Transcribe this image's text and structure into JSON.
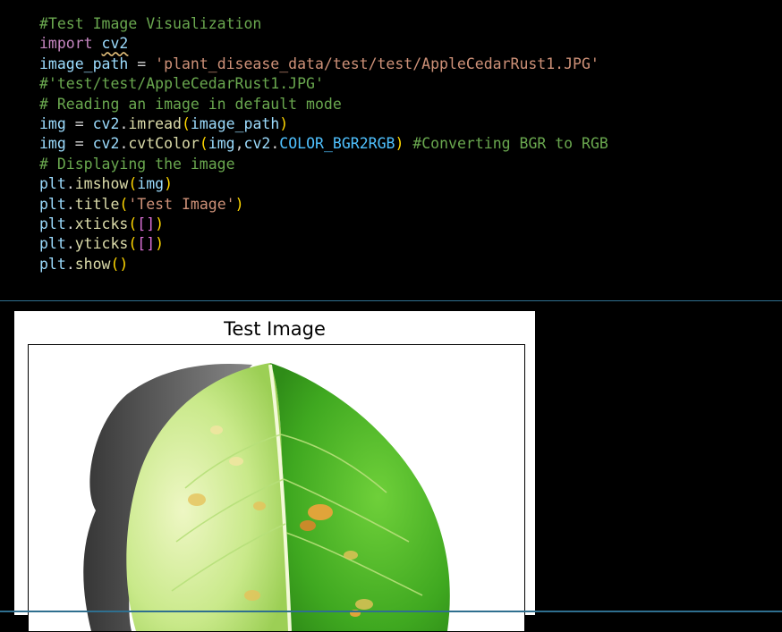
{
  "code_cell": {
    "lines": [
      [
        {
          "t": "#Test Image Visualization",
          "c": "c-comment"
        }
      ],
      [
        {
          "t": "import ",
          "c": "c-key"
        },
        {
          "t": "cv2",
          "c": "c-var squiggle"
        }
      ],
      [
        {
          "t": "image_path",
          "c": "c-var"
        },
        {
          "t": " = ",
          "c": "c-plain"
        },
        {
          "t": "'plant_disease_data/test/test/AppleCedarRust1.JPG'",
          "c": "c-str"
        }
      ],
      [
        {
          "t": "#'test/test/AppleCedarRust1.JPG'",
          "c": "c-comment"
        }
      ],
      [
        {
          "t": "# Reading an image in default mode",
          "c": "c-comment"
        }
      ],
      [
        {
          "t": "img",
          "c": "c-var"
        },
        {
          "t": " = ",
          "c": "c-plain"
        },
        {
          "t": "cv2",
          "c": "c-var"
        },
        {
          "t": ".",
          "c": "c-plain"
        },
        {
          "t": "imread",
          "c": "c-fn"
        },
        {
          "t": "(",
          "c": "c-paren"
        },
        {
          "t": "image_path",
          "c": "c-var"
        },
        {
          "t": ")",
          "c": "c-paren"
        }
      ],
      [
        {
          "t": "img",
          "c": "c-var"
        },
        {
          "t": " = ",
          "c": "c-plain"
        },
        {
          "t": "cv2",
          "c": "c-var"
        },
        {
          "t": ".",
          "c": "c-plain"
        },
        {
          "t": "cvtColor",
          "c": "c-fn"
        },
        {
          "t": "(",
          "c": "c-paren"
        },
        {
          "t": "img",
          "c": "c-var"
        },
        {
          "t": ",",
          "c": "c-plain"
        },
        {
          "t": "cv2",
          "c": "c-var"
        },
        {
          "t": ".",
          "c": "c-plain"
        },
        {
          "t": "COLOR_BGR2RGB",
          "c": "c-const"
        },
        {
          "t": ")",
          "c": "c-paren"
        },
        {
          "t": " #Converting BGR to RGB",
          "c": "c-comment"
        }
      ],
      [
        {
          "t": "# Displaying the image",
          "c": "c-comment"
        }
      ],
      [
        {
          "t": "plt",
          "c": "c-var"
        },
        {
          "t": ".",
          "c": "c-plain"
        },
        {
          "t": "imshow",
          "c": "c-fn"
        },
        {
          "t": "(",
          "c": "c-paren"
        },
        {
          "t": "img",
          "c": "c-var"
        },
        {
          "t": ")",
          "c": "c-paren"
        }
      ],
      [
        {
          "t": "plt",
          "c": "c-var"
        },
        {
          "t": ".",
          "c": "c-plain"
        },
        {
          "t": "title",
          "c": "c-fn"
        },
        {
          "t": "(",
          "c": "c-paren"
        },
        {
          "t": "'Test Image'",
          "c": "c-str"
        },
        {
          "t": ")",
          "c": "c-paren"
        }
      ],
      [
        {
          "t": "plt",
          "c": "c-var"
        },
        {
          "t": ".",
          "c": "c-plain"
        },
        {
          "t": "xticks",
          "c": "c-fn"
        },
        {
          "t": "(",
          "c": "c-paren"
        },
        {
          "t": "[]",
          "c": "c-paren2"
        },
        {
          "t": ")",
          "c": "c-paren"
        }
      ],
      [
        {
          "t": "plt",
          "c": "c-var"
        },
        {
          "t": ".",
          "c": "c-plain"
        },
        {
          "t": "yticks",
          "c": "c-fn"
        },
        {
          "t": "(",
          "c": "c-paren"
        },
        {
          "t": "[]",
          "c": "c-paren2"
        },
        {
          "t": ")",
          "c": "c-paren"
        }
      ],
      [
        {
          "t": "plt",
          "c": "c-var"
        },
        {
          "t": ".",
          "c": "c-plain"
        },
        {
          "t": "show",
          "c": "c-fn"
        },
        {
          "t": "()",
          "c": "c-paren"
        }
      ]
    ]
  },
  "output": {
    "figure_title": "Test Image",
    "image_subject": "apple-leaf-with-cedar-rust"
  },
  "colors": {
    "background": "#000000",
    "divider": "#2f6f8f",
    "leaf_light": "#d8ef9a",
    "leaf_green": "#5fbf2a",
    "rust_spot": "#e0a43a"
  }
}
